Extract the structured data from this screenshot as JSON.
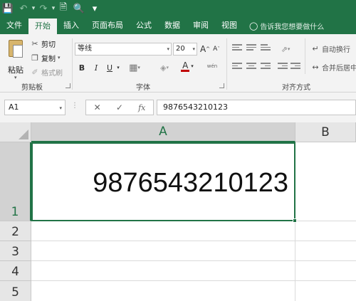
{
  "qat": {
    "icons": [
      "save-icon",
      "undo-icon",
      "redo-icon",
      "new-document-icon",
      "print-preview-icon",
      "customize-dropdown-icon"
    ]
  },
  "tabs": [
    "文件",
    "开始",
    "插入",
    "页面布局",
    "公式",
    "数据",
    "审阅",
    "视图"
  ],
  "active_tab": "开始",
  "tell_me": "告诉我您想要做什么",
  "clipboard": {
    "paste": "粘贴",
    "cut": "剪切",
    "copy": "复制",
    "format_painter": "格式刷",
    "group": "剪贴板"
  },
  "font": {
    "name": "等线",
    "size": "20",
    "bold": "B",
    "italic": "I",
    "underline": "U",
    "grow": "A",
    "shrink": "A",
    "font_color": "A",
    "phonetic": "wén",
    "group": "字体"
  },
  "alignment": {
    "wrap_text": "自动换行",
    "merge_center": "合并后居中",
    "group": "对齐方式"
  },
  "formula_bar": {
    "name_box": "A1",
    "cancel": "✕",
    "enter": "✓",
    "fx": "fx",
    "content": "9876543210123"
  },
  "sheet": {
    "columns": [
      "A",
      "B"
    ],
    "rows": [
      "1",
      "2",
      "3",
      "4",
      "5"
    ],
    "a1_value": "9876543210123",
    "selected_cell": "A1"
  },
  "colors": {
    "accent": "#217346",
    "ribbon_bg": "#f3f3f3",
    "header_bg": "#e6e6e6",
    "font_color_underline": "#c00000"
  }
}
